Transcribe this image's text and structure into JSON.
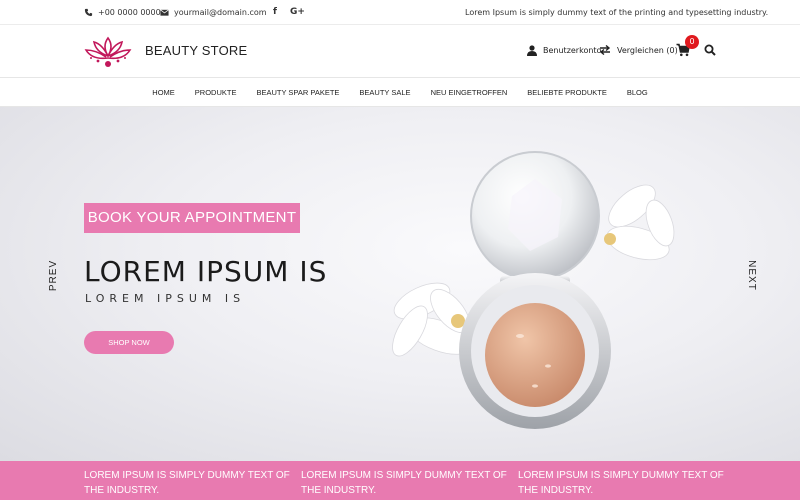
{
  "topbar": {
    "phone": "+00 0000 0000",
    "email": "yourmail@domain.com",
    "social": [
      "f",
      "G+"
    ],
    "tagline": "Lorem Ipsum is simply dummy text of the printing and typesetting industry."
  },
  "header": {
    "brand": "BEAUTY STORE",
    "account_label": "Benutzerkonto",
    "compare_label": "Vergleichen (0)",
    "cart_count": "0",
    "icons": [
      "user-icon",
      "compare-icon",
      "cart-icon",
      "search-icon"
    ]
  },
  "nav": {
    "items": [
      "HOME",
      "PRODUKTE",
      "BEAUTY SPAR PAKETE",
      "BEAUTY SALE",
      "NEU EINGETROFFEN",
      "BELIEBTE PRODUKTE",
      "BLOG"
    ]
  },
  "hero": {
    "appointment": "BOOK YOUR APPOINTMENT",
    "title": "LOREM IPSUM IS",
    "subtitle": "LOREM IPSUM IS",
    "cta": "SHOP NOW",
    "prev": "PREV",
    "next": "NEXT"
  },
  "strip": {
    "columns": [
      "LOREM IPSUM IS SIMPLY DUMMY TEXT OF THE INDUSTRY.",
      "LOREM IPSUM IS SIMPLY DUMMY TEXT OF THE INDUSTRY.",
      "LOREM IPSUM IS SIMPLY DUMMY TEXT OF THE INDUSTRY."
    ]
  },
  "colors": {
    "accent": "#e87ab0",
    "logo": "#c2185b",
    "badge": "#e0191e"
  }
}
